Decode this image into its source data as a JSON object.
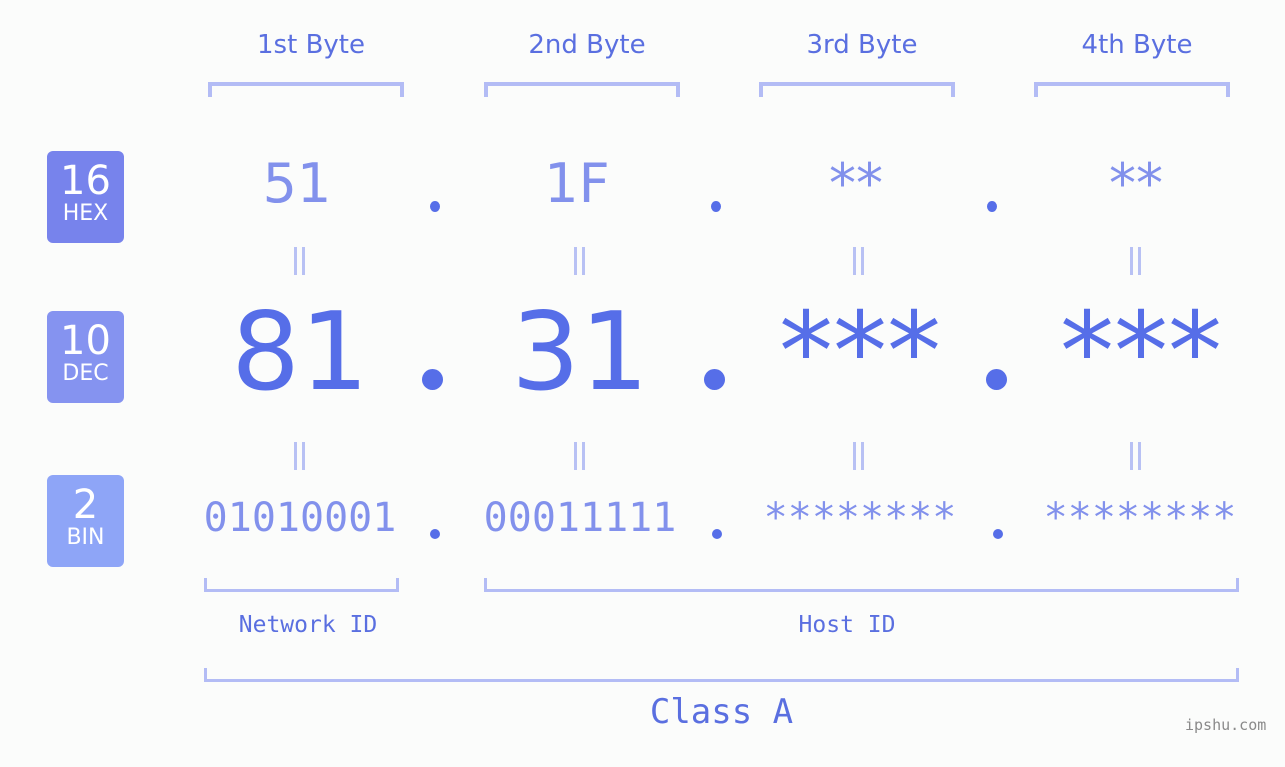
{
  "bytes": [
    {
      "label": "1st Byte",
      "hex": "51",
      "dec": "81",
      "bin": "01010001"
    },
    {
      "label": "2nd Byte",
      "hex": "1F",
      "dec": "31",
      "bin": "00011111"
    },
    {
      "label": "3rd Byte",
      "hex": "**",
      "dec": "***",
      "bin": "********"
    },
    {
      "label": "4th Byte",
      "hex": "**",
      "dec": "***",
      "bin": "********"
    }
  ],
  "badges": {
    "hex": {
      "num": "16",
      "sub": "HEX",
      "color": "#7783ec"
    },
    "dec": {
      "num": "10",
      "sub": "DEC",
      "color": "#8593f0"
    },
    "bin": {
      "num": "2",
      "sub": "BIN",
      "color": "#8ea5f7"
    }
  },
  "segments": {
    "network": "Network ID",
    "host": "Host ID"
  },
  "ip_class": "Class A",
  "watermark": "ipshu.com",
  "colors": {
    "primary": "#566ee8",
    "secondary": "#8291ec",
    "bracket": "#b3bcf5",
    "background": "#fbfcfb"
  }
}
